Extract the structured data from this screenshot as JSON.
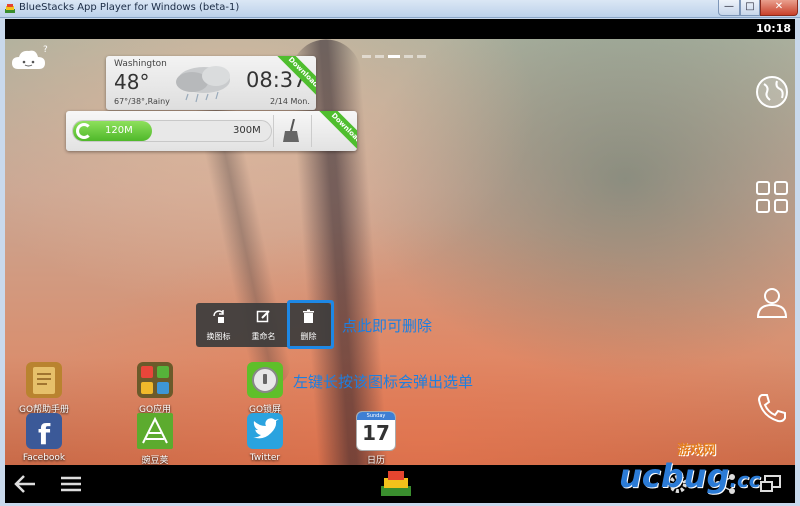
{
  "window": {
    "title": "BlueStacks App Player for Windows (beta-1)",
    "min": "—",
    "max": "□",
    "close": "✕"
  },
  "status": {
    "time": "10:18"
  },
  "weather": {
    "city": "Washington",
    "temp": "48°",
    "cond": "67°/38°,Rainy",
    "time": "08:37",
    "date": "2/14 Mon.",
    "ribbon": "Download"
  },
  "memory": {
    "used": "120M",
    "total": "300M",
    "ribbon": "Download",
    "fill_fraction": 0.4
  },
  "context_menu": [
    {
      "label": "换图标",
      "icon": "change-icon-icon"
    },
    {
      "label": "重命名",
      "icon": "rename-icon"
    },
    {
      "label": "删除",
      "icon": "trash-icon"
    }
  ],
  "annotations": {
    "delete_hint": "点此即可删除",
    "longpress_hint": "左键长按该图标会弹出选单"
  },
  "apps": [
    {
      "label": "GO帮助手册",
      "icon": "go-help-icon",
      "color": "#b9832f"
    },
    {
      "label": "GO应用",
      "icon": "go-apps-icon",
      "color": "#6b5a2a"
    },
    {
      "label": "GO锁屏",
      "icon": "go-locker-icon",
      "color": "#5fbf2a"
    },
    {
      "label": "Facebook",
      "icon": "facebook-icon",
      "color": "#3b5998"
    },
    {
      "label": "豌豆荚",
      "icon": "wandoujia-icon",
      "color": "#5cab2e"
    },
    {
      "label": "Twitter",
      "icon": "twitter-icon",
      "color": "#2aa3df"
    },
    {
      "label": "日历",
      "icon": "calendar-icon",
      "color": "#ffffff"
    }
  ],
  "calendar": {
    "day": "17",
    "weekday": "Sunday"
  },
  "watermark": {
    "main": "ucbug",
    "domain": ".cc",
    "sub": "游戏网"
  }
}
